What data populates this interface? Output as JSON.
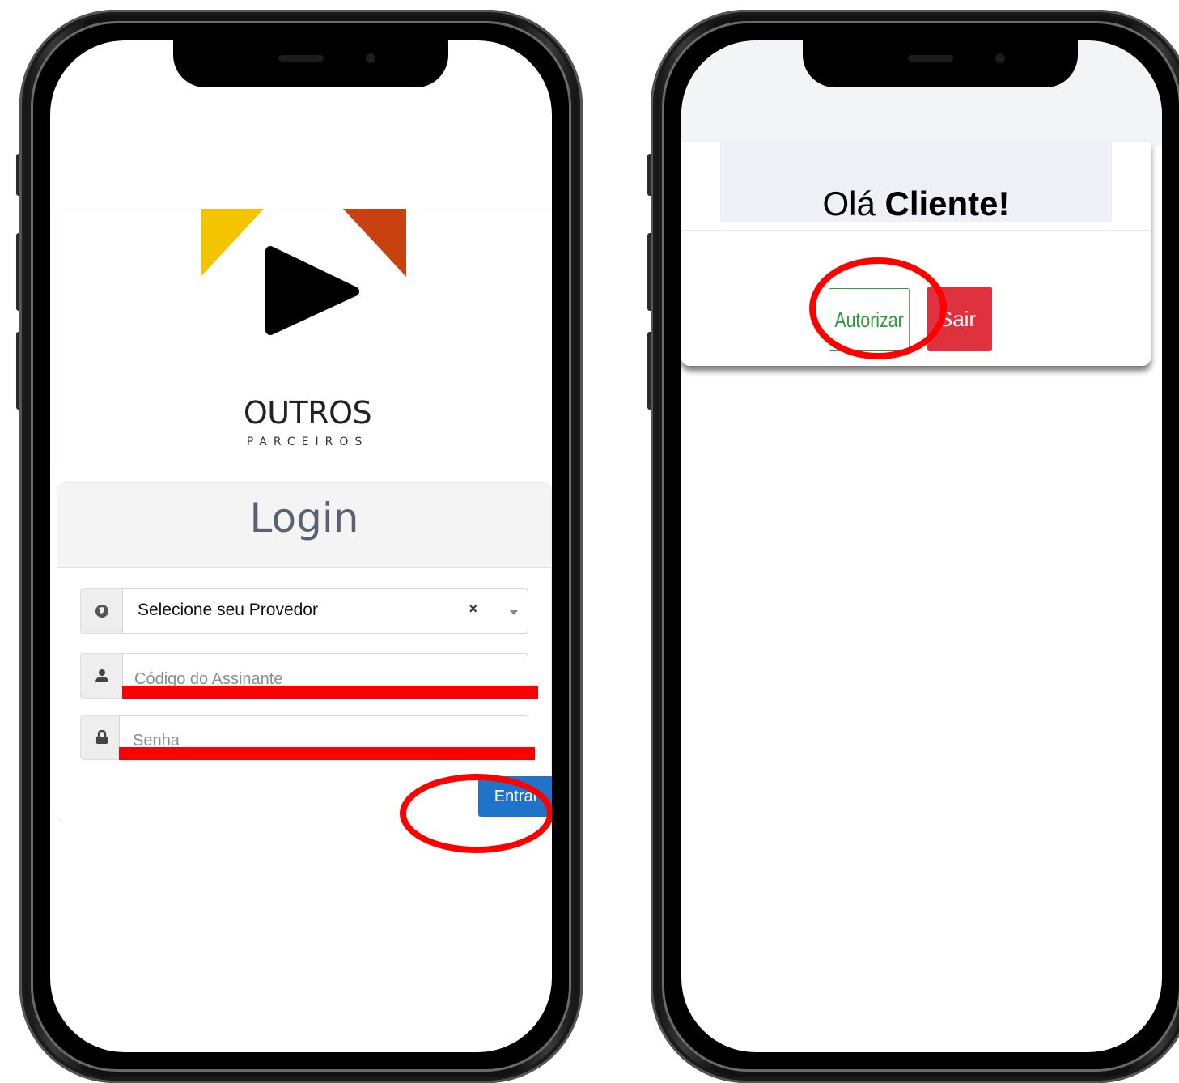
{
  "login_screen": {
    "brand": {
      "name": "OUTROS",
      "tagline": "PARCEIROS"
    },
    "title": "Login",
    "provider_select": {
      "value": "Selecione seu Provedor",
      "clear_symbol": "×"
    },
    "subscriber_code": {
      "placeholder": "Código do Assinante"
    },
    "password": {
      "placeholder": "Senha"
    },
    "submit_label": "Entrar",
    "logo_colors": {
      "yellow": "#f5c400",
      "orange": "#c8420f",
      "blue": "#3b6aa5",
      "green": "#0c6a3a",
      "play": "#000000"
    },
    "icons": {
      "provider": "globe-icon",
      "subscriber": "user-icon",
      "password": "lock-icon"
    }
  },
  "consent_screen": {
    "greeting_prefix": "Olá",
    "greeting_name": "Cliente!",
    "authorize_label": "Autorizar",
    "exit_label": "Sair",
    "colors": {
      "authorize": "#2e9a3d",
      "exit": "#e0313f"
    }
  },
  "annotations": {
    "highlight_color": "#ff0000"
  }
}
